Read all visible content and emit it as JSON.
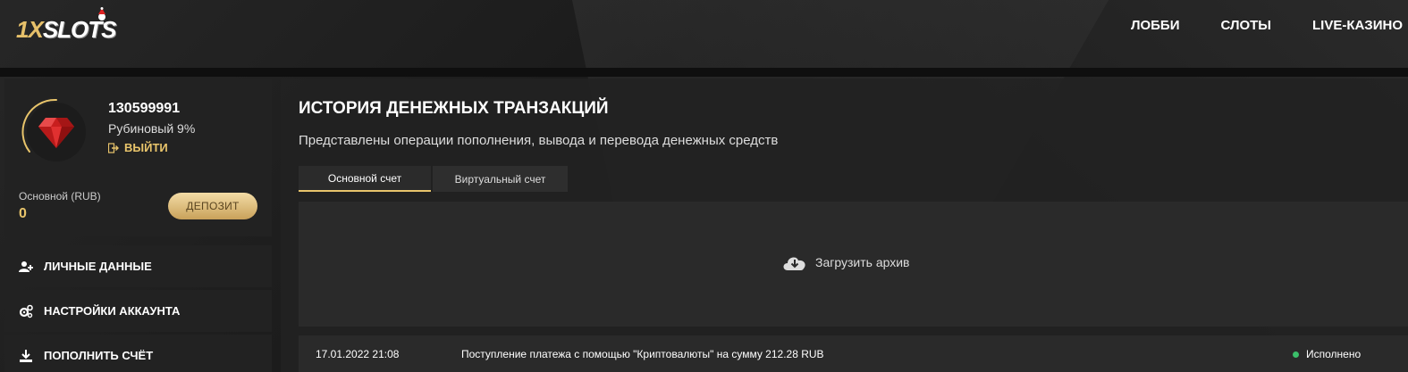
{
  "header": {
    "logo_prefix": "1X",
    "logo_suffix": "SLOTS",
    "nav": [
      "ЛОББИ",
      "СЛОТЫ",
      "LIVE-КАЗИНО"
    ]
  },
  "profile": {
    "user_id": "130599991",
    "level": "Рубиновый 9%",
    "logout_label": "ВЫЙТИ",
    "balance_label": "Основной (RUB)",
    "balance_value": "0",
    "deposit_label": "ДЕПОЗИТ",
    "level_progress_percent": 9
  },
  "sidebar": {
    "items": [
      {
        "label": "ЛИЧНЫЕ ДАННЫЕ",
        "icon": "user-add-icon"
      },
      {
        "label": "НАСТРОЙКИ АККАУНТА",
        "icon": "gears-icon"
      },
      {
        "label": "ПОПОЛНИТЬ СЧЁТ",
        "icon": "download-icon"
      }
    ]
  },
  "main": {
    "title": "ИСТОРИЯ ДЕНЕЖНЫХ ТРАНЗАКЦИЙ",
    "subtitle": "Представлены операции пополнения, вывода и перевода денежных средств",
    "tabs": [
      {
        "label": "Основной счет",
        "active": true
      },
      {
        "label": "Виртуальный счет",
        "active": false
      }
    ],
    "archive_label": "Загрузить архив",
    "transactions": [
      {
        "date": "17.01.2022 21:08",
        "description": "Поступление платежа с помощью \"Криптовалюты\" на сумму 212.28 RUB",
        "status": "Исполнено"
      }
    ]
  },
  "colors": {
    "accent": "#e8c46b",
    "status_ok": "#3bbf6a"
  }
}
